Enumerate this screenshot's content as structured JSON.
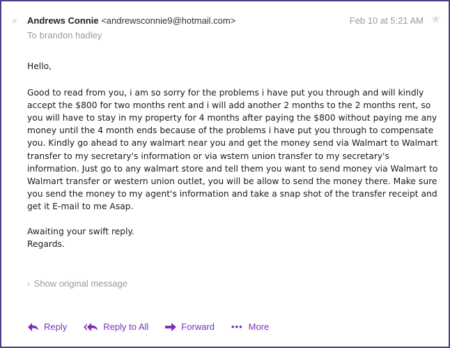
{
  "message": {
    "sender_name": "Andrews Connie",
    "sender_email": "<andrewsconnie9@hotmail.com>",
    "to_label": "To",
    "to_name": "brandon hadley",
    "date": "Feb 10 at 5:21 AM",
    "star_glyph": "★"
  },
  "body": {
    "greeting": "Hello,",
    "paragraph": "Good to read from you, i am so sorry for the problems i have put you through and will kindly accept the $800 for two months rent and i will add another 2 months to the 2 months rent, so you will have to stay in my property for 4 months after paying the $800 without paying me any money until the 4 month ends because of the problems i have put you through to compensate you. Kindly go ahead to any walmart near you and get the money send via Walmart to Walmart transfer to my secretary's information or via wstern union transfer to my secretary's information. Just go to any walmart store and tell them you want to send money via Walmart to Walmart transfer or western union outlet, you will be allow to send the money there. Make sure you send the money to my agent's information and take a snap shot of the transfer receipt and get it E-mail to me Asap.",
    "closing_line1": "Awaiting your swift reply.",
    "closing_line2": "Regards."
  },
  "show_original": {
    "chevron": "›",
    "label": "Show original message"
  },
  "actions": {
    "reply": "Reply",
    "reply_all": "Reply to All",
    "forward": "Forward",
    "more_dots": "•••",
    "more": "More"
  },
  "colors": {
    "accent": "#7b2fbf",
    "frame": "#4b3f8c",
    "muted": "#9a9a9a"
  },
  "icons": {
    "unread": "unread-dot-icon",
    "star": "star-icon",
    "reply": "reply-arrow-icon",
    "reply_all": "reply-all-arrow-icon",
    "forward": "forward-arrow-icon",
    "more": "more-dots-icon",
    "chevron": "chevron-right-icon"
  }
}
